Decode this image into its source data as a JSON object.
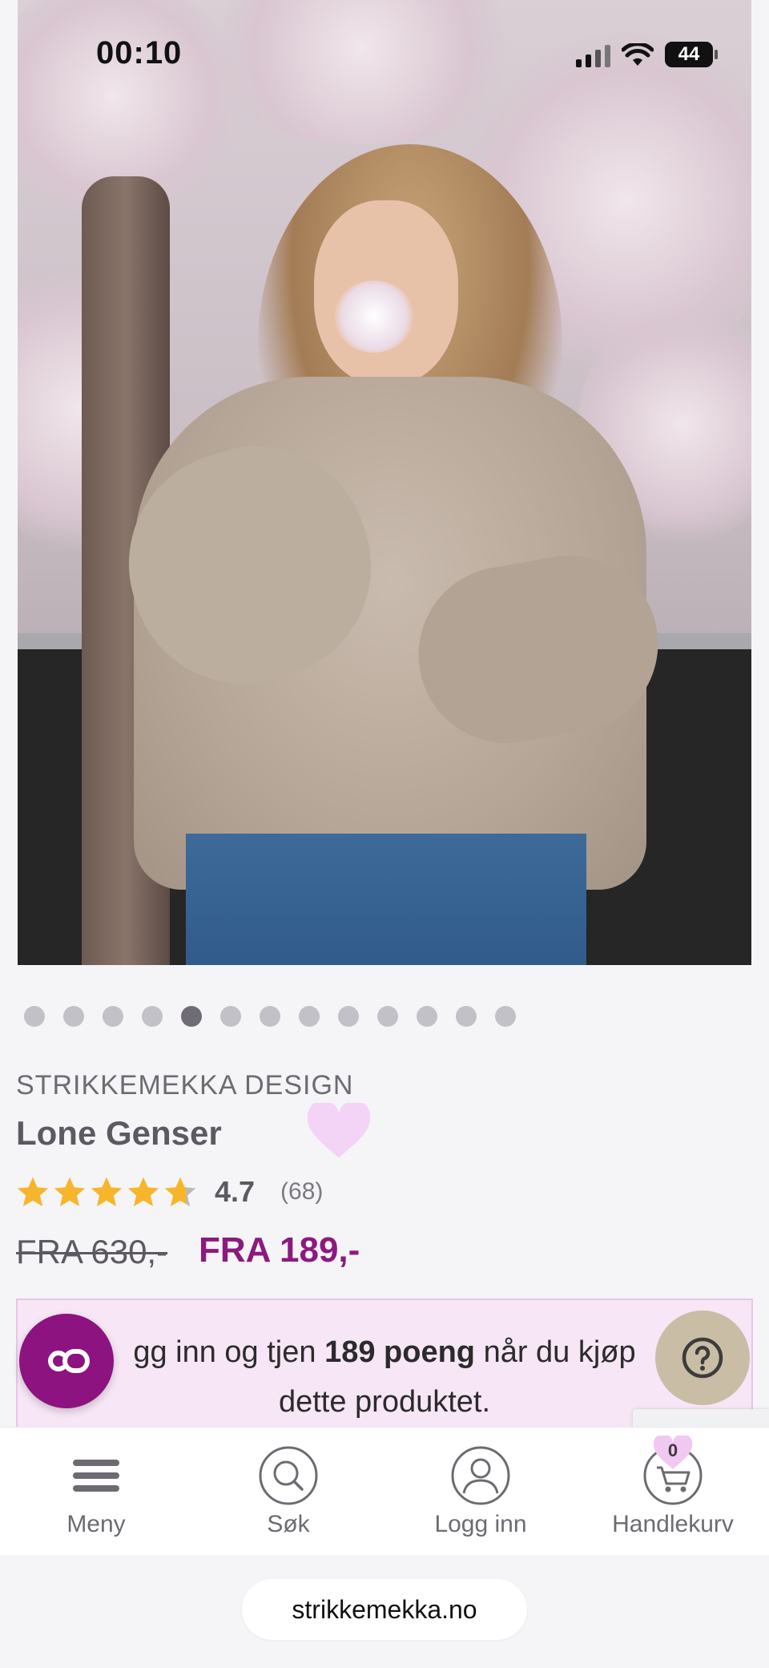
{
  "status_bar": {
    "time": "00:10",
    "battery": "44"
  },
  "product": {
    "brand": "STRIKKEMEKKA DESIGN",
    "title": "Lone Genser",
    "rating_value": "4.7",
    "rating_count": "(68)",
    "rating_fraction": 0.94,
    "price_old": "FRA 630,-",
    "price_new": "FRA 189,-"
  },
  "carousel": {
    "total": 13,
    "active_index": 4
  },
  "points_banner": {
    "before": "gg inn og tjen ",
    "highlight": "189 poeng",
    "after": " når du kjøp",
    "line2": "dette produktet."
  },
  "fab": {
    "co_label": "CO",
    "help_label": "?"
  },
  "bottom_nav": {
    "menu": "Meny",
    "search": "Søk",
    "login": "Logg inn",
    "cart": "Handlekurv",
    "cart_count": "0"
  },
  "url": "strikkemekka.no",
  "colors": {
    "accent": "#8c1a7e",
    "star": "#f7b52c",
    "heart": "#f3d4f7",
    "help_fab": "#c9bda6"
  }
}
